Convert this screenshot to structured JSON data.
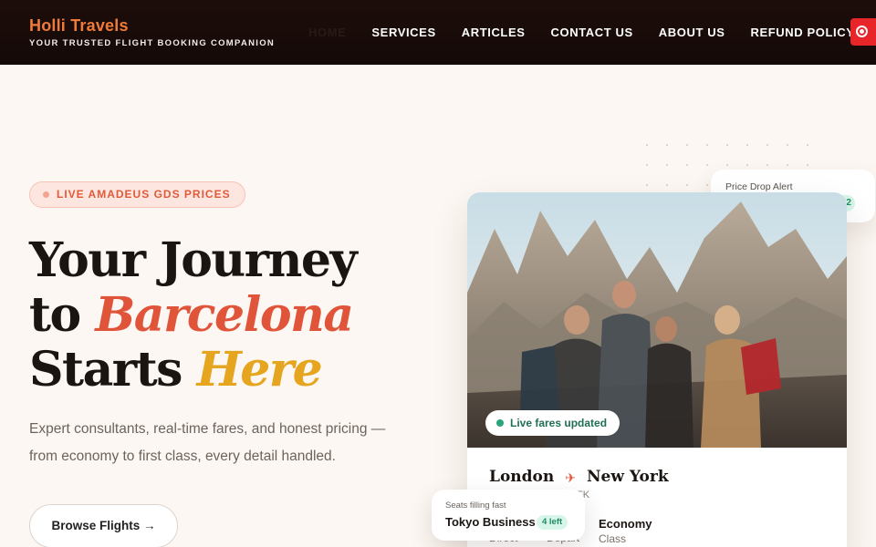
{
  "brand": {
    "name": "Holli Travels",
    "tagline": "YOUR TRUSTED FLIGHT BOOKING COMPANION"
  },
  "nav": {
    "items": [
      {
        "label": "HOME",
        "active": true
      },
      {
        "label": "SERVICES",
        "active": false
      },
      {
        "label": "ARTICLES",
        "active": false
      },
      {
        "label": "CONTACT US",
        "active": false
      },
      {
        "label": "ABOUT US",
        "active": false
      },
      {
        "label": "REFUND POLICY",
        "active": false
      }
    ],
    "cta_icon": "record-icon"
  },
  "hero": {
    "badge": "LIVE AMADEUS GDS PRICES",
    "headline_line1": "Your Journey",
    "headline_to": "to ",
    "headline_city": "Barcelona",
    "headline_starts": "Starts ",
    "headline_here": "Here",
    "subtitle": "Expert consultants, real-time fares, and honest pricing — from economy to first class, every detail handled.",
    "browse_button": "Browse Flights →"
  },
  "card": {
    "live_pill": "Live fares updated",
    "from_city": "London",
    "to_city": "New York",
    "to_code": "FK",
    "meta": [
      {
        "value": "",
        "label": "Direct"
      },
      {
        "value": "",
        "label": "Depart"
      },
      {
        "value": "Economy",
        "label": "Class"
      }
    ]
  },
  "price_alert": {
    "label": "Price Drop Alert",
    "chip": "42"
  },
  "seats": {
    "label": "Seats filling fast",
    "value": "Tokyo Business",
    "chip": "4 left"
  },
  "colors": {
    "accent_orange": "#e0553a",
    "accent_yellow": "#e6a51e",
    "nav_bg": "#1d0d0a",
    "success_green": "#2aa57c"
  }
}
